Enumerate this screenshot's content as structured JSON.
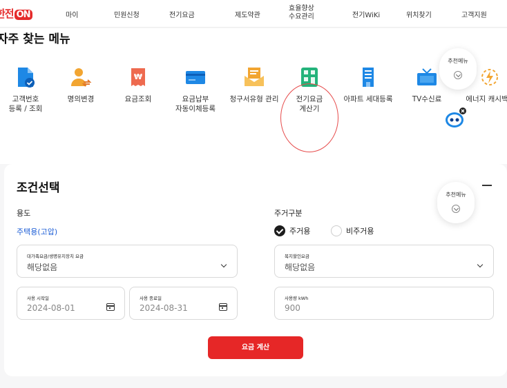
{
  "header": {
    "logo_text": "한전",
    "logo_on": "ON",
    "nav": [
      "마이",
      "민원신청",
      "전기요금",
      "제도약관",
      "효율향상\n수요관리",
      "전기WiKi",
      "위치찾기",
      "고객지원"
    ]
  },
  "frequent": {
    "title": "자주 찾는 메뉴",
    "items": [
      {
        "label": "고객번호\n등록 / 조회",
        "icon": "document-check-icon"
      },
      {
        "label": "명의변경",
        "icon": "person-transfer-icon"
      },
      {
        "label": "요금조회",
        "icon": "won-receipt-icon"
      },
      {
        "label": "요금납부\n자동이체등록",
        "icon": "credit-card-icon"
      },
      {
        "label": "청구서유형 관리",
        "icon": "envelope-icon"
      },
      {
        "label": "전기요금\n계산기",
        "icon": "calculator-icon"
      },
      {
        "label": "아파트 세대등록",
        "icon": "apartment-icon"
      },
      {
        "label": "TV수신료",
        "icon": "tv-icon"
      },
      {
        "label": "에너지 캐시백",
        "icon": "energy-cashback-icon"
      }
    ]
  },
  "recommend": {
    "label": "추천메뉴"
  },
  "conditions": {
    "title": "조건선택",
    "usage_label": "용도",
    "usage_value": "주택용(고압)",
    "residence_label": "주거구분",
    "residence_options": [
      {
        "label": "주거용",
        "checked": true
      },
      {
        "label": "비주거용",
        "checked": false
      }
    ],
    "large_family_label": "대가족요금/생명유지장치 요금",
    "large_family_value": "해당없음",
    "welfare_label": "복지할인요금",
    "welfare_value": "해당없음",
    "start_label": "사용 시작일",
    "start_value": "2024-08-01",
    "end_label": "사용 종료일",
    "end_value": "2024-08-31",
    "kwh_label": "사용량 kWh",
    "kwh_placeholder": "900",
    "calc_button": "요금 계산"
  },
  "colors": {
    "brand": "#e62727",
    "link": "#1f5fd6",
    "accent_blue": "#1e88e5",
    "accent_green": "#24b37b",
    "accent_orange": "#f2a531"
  }
}
